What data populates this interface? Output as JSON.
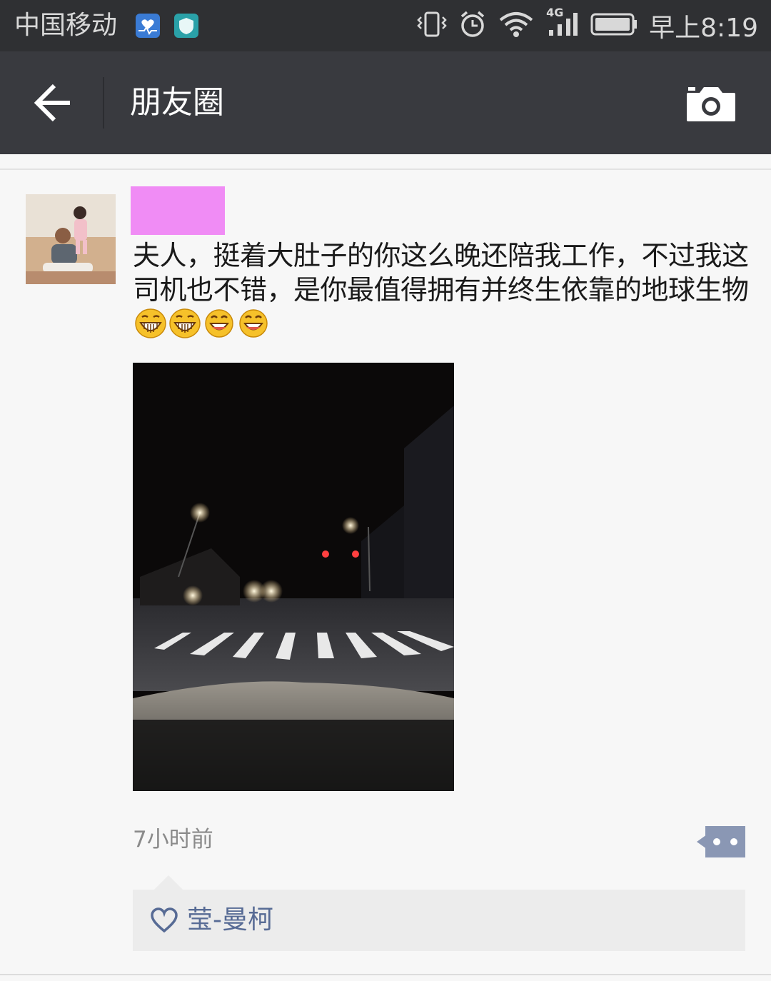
{
  "status_bar": {
    "carrier": "中国移动",
    "network": "4G",
    "time": "早上8:19",
    "icons": [
      "health-app-icon",
      "shield-app-icon",
      "vibrate-icon",
      "alarm-icon",
      "wifi-icon",
      "signal-icon",
      "battery-icon"
    ]
  },
  "nav": {
    "title": "朋友圈",
    "back_icon": "arrow-left-icon",
    "camera_icon": "camera-icon"
  },
  "post": {
    "text": "夫人，挺着大肚子的你这么晚还陪我工作，不过我这司机也不错，是你最值得拥有并终生依靠的地球生物",
    "emojis": [
      "grin-emoji",
      "grin-emoji",
      "smile-emoji",
      "smile-emoji"
    ],
    "time": "7小时前",
    "comment_icon": "comment-dots-icon",
    "likes": [
      "莹-曼柯"
    ]
  },
  "colors": {
    "status_bar_bg": "#2f3033",
    "nav_bg": "#393a3f",
    "page_bg": "#f7f7f7",
    "username_redaction": "#f08cf5",
    "link_blue": "#576b95",
    "like_box_bg": "#ececec"
  }
}
